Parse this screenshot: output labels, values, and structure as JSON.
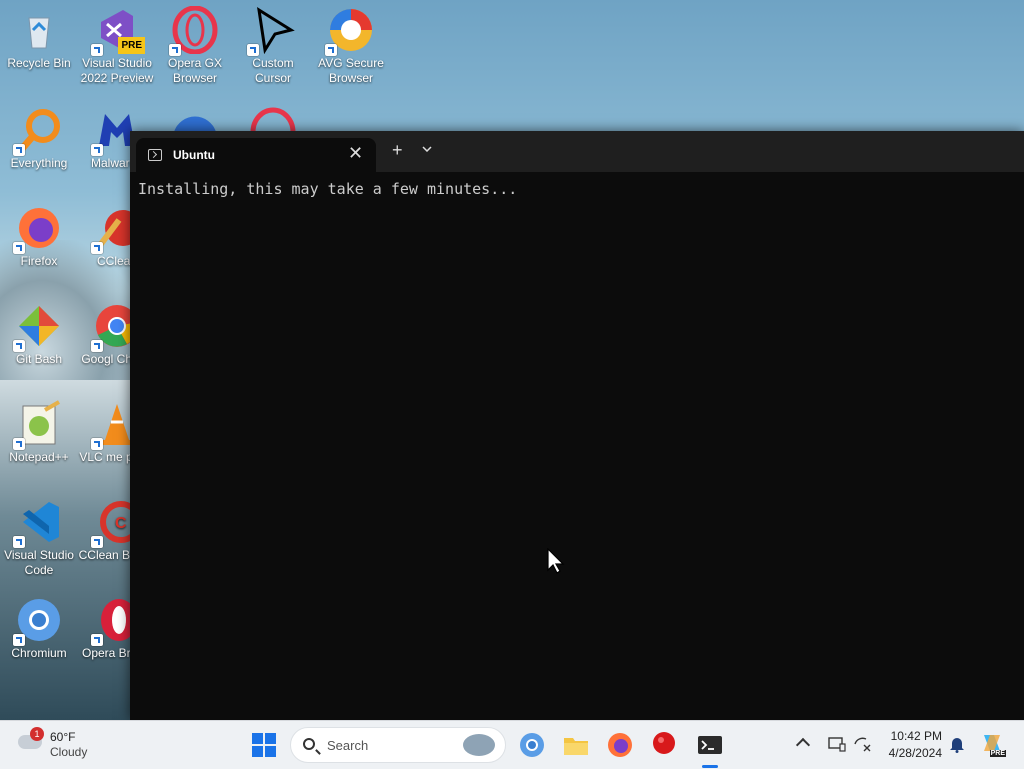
{
  "desktop": {
    "icons": [
      {
        "label": "Recycle Bin"
      },
      {
        "label": "Visual Studio 2022 Preview",
        "badge": "PRE"
      },
      {
        "label": "Opera GX Browser"
      },
      {
        "label": "Custom Cursor"
      },
      {
        "label": "AVG Secure Browser"
      },
      {
        "label": "Everything"
      },
      {
        "label": "Malwareb"
      },
      {
        "label": "Firefox"
      },
      {
        "label": "CClean"
      },
      {
        "label": "Git Bash"
      },
      {
        "label": "Googl Chrom"
      },
      {
        "label": "Notepad++"
      },
      {
        "label": "VLC me playe"
      },
      {
        "label": "Visual Studio Code"
      },
      {
        "label": "CClean Brows"
      },
      {
        "label": "Chromium"
      },
      {
        "label": "Opera Brows"
      }
    ]
  },
  "terminal": {
    "tab_title": "Ubuntu",
    "close_glyph": "✕",
    "newtab_glyph": "+",
    "dropdown_glyph": "⌄",
    "output": "Installing, this may take a few minutes..."
  },
  "taskbar": {
    "weather": {
      "temp": "60°F",
      "desc": "Cloudy",
      "badge": "1"
    },
    "search_placeholder": "Search",
    "clock": {
      "time": "10:42 PM",
      "date": "4/28/2024"
    },
    "copilot_badge": "PRE"
  },
  "colors": {
    "terminal_bg": "#0c0c0c",
    "titlebar_bg": "#1f1f1f",
    "taskbar_bg": "#eef1f4",
    "accent": "#1a73e8"
  }
}
